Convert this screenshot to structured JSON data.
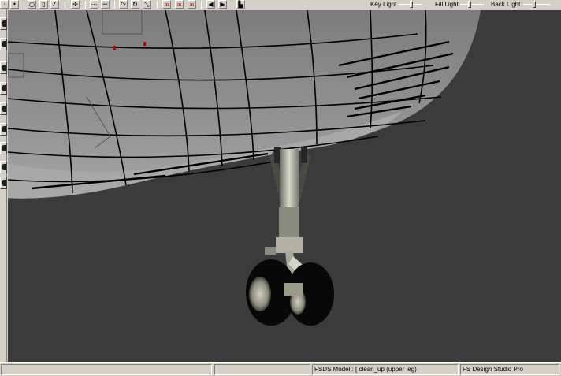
{
  "toolbar": {
    "icons": [
      "arrow-icon",
      "dot-icon",
      "circle-icon",
      "line-icon",
      "angle-icon",
      "move-icon",
      "grid-icon",
      "list-icon",
      "redo-icon",
      "rotate-icon",
      "scale-icon",
      "link-red-icon",
      "link-red-2-icon",
      "link-red-3-icon",
      "play-back-icon",
      "play-forward-icon",
      "save-icon"
    ],
    "key_light_label": "Key Light",
    "fill_light_label": "Fill Light",
    "back_light_label": "Back Light"
  },
  "statusbar": {
    "left_text": "",
    "model_text": "FSDS Model : [ clean_up (upper leg)",
    "app_text": "FS Design Studio Pro"
  },
  "colors": {
    "viewport_bg": "#3b3b3b",
    "fuselage": "#8a8a8a",
    "panel_lines": "#000000",
    "ui_face": "#d4d0c8",
    "accent_red": "#c00000"
  }
}
